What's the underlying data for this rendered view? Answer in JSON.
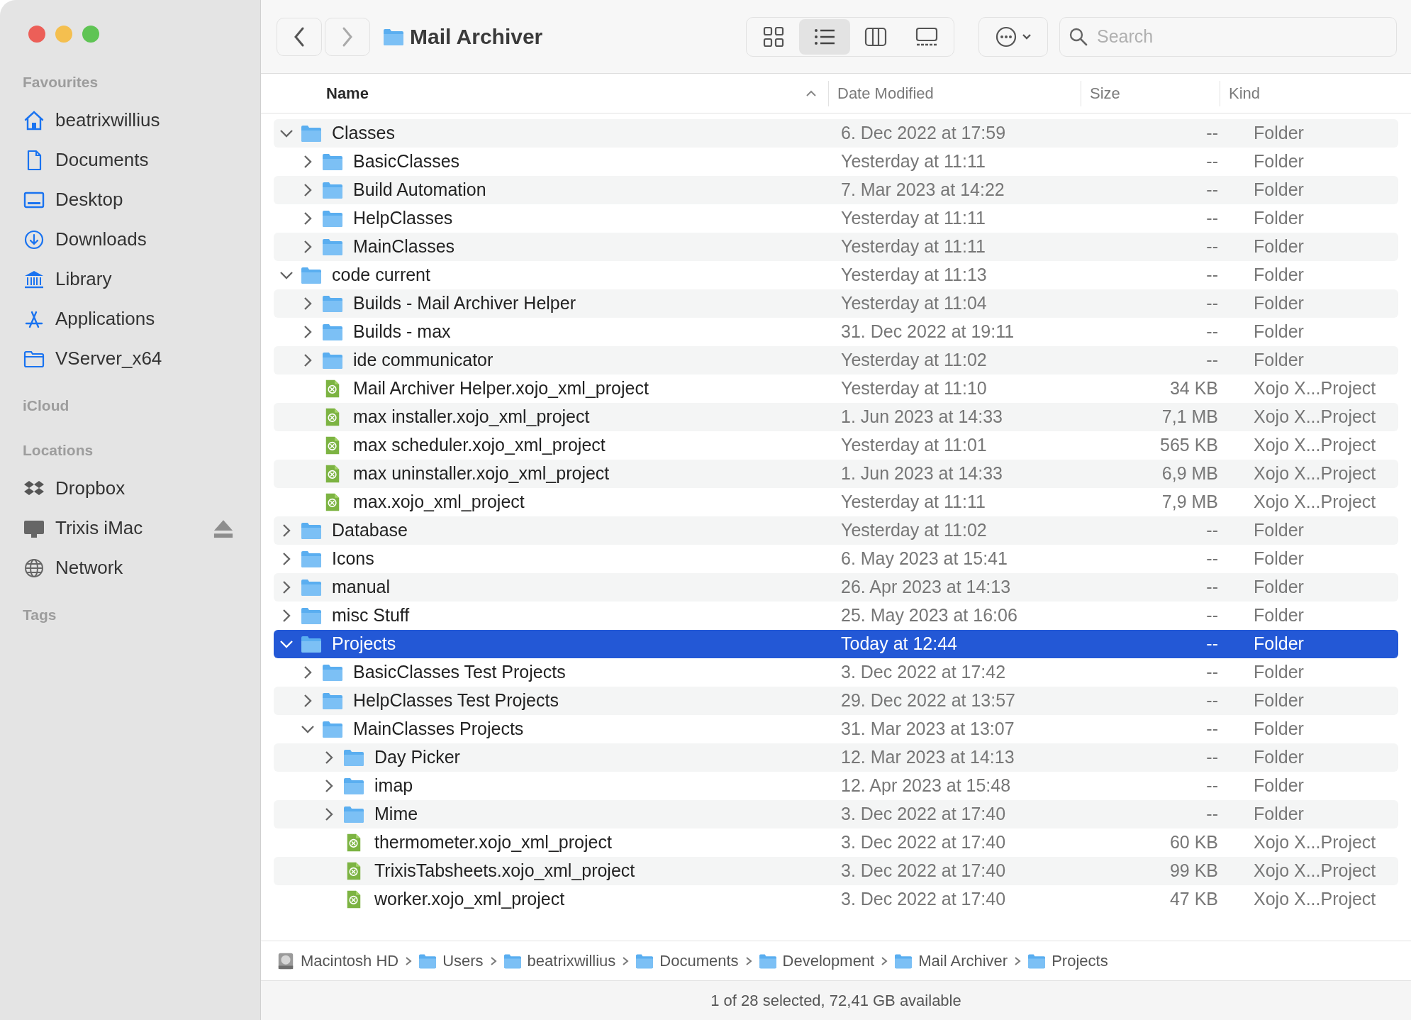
{
  "sidebar": {
    "sections": [
      {
        "title": "Favourites",
        "items": [
          {
            "label": "beatrixwillius",
            "kind": "home"
          },
          {
            "label": "Documents",
            "kind": "document"
          },
          {
            "label": "Desktop",
            "kind": "desktop"
          },
          {
            "label": "Downloads",
            "kind": "download"
          },
          {
            "label": "Library",
            "kind": "library"
          },
          {
            "label": "Applications",
            "kind": "apps"
          },
          {
            "label": "VServer_x64",
            "kind": "folder"
          }
        ]
      },
      {
        "title": "iCloud"
      },
      {
        "title": "Locations",
        "items": [
          {
            "label": "Dropbox",
            "kind": "dropbox"
          },
          {
            "label": "Trixis iMac",
            "kind": "computer",
            "ejectable": true
          },
          {
            "label": "Network",
            "kind": "network"
          }
        ]
      },
      {
        "title": "Tags"
      }
    ]
  },
  "toolbar": {
    "title": "Mail Archiver",
    "views": [
      {
        "kind": "icons",
        "selected": false
      },
      {
        "kind": "list",
        "selected": true
      },
      {
        "kind": "columns",
        "selected": false
      },
      {
        "kind": "gallery",
        "selected": false
      }
    ],
    "search": {
      "placeholder": "Search"
    }
  },
  "table": {
    "columns": [
      {
        "label": "Name",
        "sorted": true
      },
      {
        "label": "Date Modified",
        "sorted": false
      },
      {
        "label": "Size",
        "sorted": false
      },
      {
        "label": "Kind",
        "sorted": false
      }
    ],
    "rows": [
      {
        "name": "Classes",
        "kind": "folder",
        "expanded": true,
        "selected": false,
        "date": "6. Dec 2022 at 17:59",
        "size": "--",
        "type": "Folder",
        "children": [
          {
            "name": "BasicClasses",
            "kind": "folder",
            "expanded": false,
            "selected": false,
            "date": "Yesterday at 11:11",
            "size": "--",
            "type": "Folder"
          },
          {
            "name": "Build Automation",
            "kind": "folder",
            "expanded": false,
            "selected": false,
            "date": "7. Mar 2023 at 14:22",
            "size": "--",
            "type": "Folder"
          },
          {
            "name": "HelpClasses",
            "kind": "folder",
            "expanded": false,
            "selected": false,
            "date": "Yesterday at 11:11",
            "size": "--",
            "type": "Folder"
          },
          {
            "name": "MainClasses",
            "kind": "folder",
            "expanded": false,
            "selected": false,
            "date": "Yesterday at 11:11",
            "size": "--",
            "type": "Folder"
          }
        ]
      },
      {
        "name": "code current",
        "kind": "folder",
        "expanded": true,
        "selected": false,
        "date": "Yesterday at 11:13",
        "size": "--",
        "type": "Folder",
        "children": [
          {
            "name": "Builds - Mail Archiver Helper",
            "kind": "folder",
            "expanded": false,
            "selected": false,
            "date": "Yesterday at 11:04",
            "size": "--",
            "type": "Folder"
          },
          {
            "name": "Builds - max",
            "kind": "folder",
            "expanded": false,
            "selected": false,
            "date": "31. Dec 2022 at 19:11",
            "size": "--",
            "type": "Folder"
          },
          {
            "name": "ide communicator",
            "kind": "folder",
            "expanded": false,
            "selected": false,
            "date": "Yesterday at 11:02",
            "size": "--",
            "type": "Folder"
          },
          {
            "name": "Mail Archiver Helper.xojo_xml_project",
            "kind": "project",
            "selected": false,
            "date": "Yesterday at 11:10",
            "size": "34 KB",
            "type": "Xojo X...Project"
          },
          {
            "name": "max installer.xojo_xml_project",
            "kind": "project",
            "selected": false,
            "date": "1. Jun 2023 at 14:33",
            "size": "7,1 MB",
            "type": "Xojo X...Project"
          },
          {
            "name": "max scheduler.xojo_xml_project",
            "kind": "project",
            "selected": false,
            "date": "Yesterday at 11:01",
            "size": "565 KB",
            "type": "Xojo X...Project"
          },
          {
            "name": "max uninstaller.xojo_xml_project",
            "kind": "project",
            "selected": false,
            "date": "1. Jun 2023 at 14:33",
            "size": "6,9 MB",
            "type": "Xojo X...Project"
          },
          {
            "name": "max.xojo_xml_project",
            "kind": "project",
            "selected": false,
            "date": "Yesterday at 11:11",
            "size": "7,9 MB",
            "type": "Xojo X...Project"
          }
        ]
      },
      {
        "name": "Database",
        "kind": "folder",
        "expanded": false,
        "selected": false,
        "date": "Yesterday at 11:02",
        "size": "--",
        "type": "Folder"
      },
      {
        "name": "Icons",
        "kind": "folder",
        "expanded": false,
        "selected": false,
        "date": "6. May 2023 at 15:41",
        "size": "--",
        "type": "Folder"
      },
      {
        "name": "manual",
        "kind": "folder",
        "expanded": false,
        "selected": false,
        "date": "26. Apr 2023 at 14:13",
        "size": "--",
        "type": "Folder"
      },
      {
        "name": "misc Stuff",
        "kind": "folder",
        "expanded": false,
        "selected": false,
        "date": "25. May 2023 at 16:06",
        "size": "--",
        "type": "Folder"
      },
      {
        "name": "Projects",
        "kind": "folder",
        "expanded": true,
        "selected": true,
        "date": "Today at 12:44",
        "size": "--",
        "type": "Folder",
        "children": [
          {
            "name": "BasicClasses Test Projects",
            "kind": "folder",
            "expanded": false,
            "selected": false,
            "date": "3. Dec 2022 at 17:42",
            "size": "--",
            "type": "Folder"
          },
          {
            "name": "HelpClasses Test Projects",
            "kind": "folder",
            "expanded": false,
            "selected": false,
            "date": "29. Dec 2022 at 13:57",
            "size": "--",
            "type": "Folder"
          },
          {
            "name": "MainClasses Projects",
            "kind": "folder",
            "expanded": true,
            "selected": false,
            "date": "31. Mar 2023 at 13:07",
            "size": "--",
            "type": "Folder",
            "children": [
              {
                "name": "Day Picker",
                "kind": "folder",
                "expanded": false,
                "selected": false,
                "date": "12. Mar 2023 at 14:13",
                "size": "--",
                "type": "Folder"
              },
              {
                "name": "imap",
                "kind": "folder",
                "expanded": false,
                "selected": false,
                "date": "12. Apr 2023 at 15:48",
                "size": "--",
                "type": "Folder"
              },
              {
                "name": "Mime",
                "kind": "folder",
                "expanded": false,
                "selected": false,
                "date": "3. Dec 2022 at 17:40",
                "size": "--",
                "type": "Folder"
              },
              {
                "name": "thermometer.xojo_xml_project",
                "kind": "project",
                "selected": false,
                "date": "3. Dec 2022 at 17:40",
                "size": "60 KB",
                "type": "Xojo X...Project"
              },
              {
                "name": "TrixisTabsheets.xojo_xml_project",
                "kind": "project",
                "selected": false,
                "date": "3. Dec 2022 at 17:40",
                "size": "99 KB",
                "type": "Xojo X...Project"
              },
              {
                "name": "worker.xojo_xml_project",
                "kind": "project",
                "selected": false,
                "date": "3. Dec 2022 at 17:40",
                "size": "47 KB",
                "type": "Xojo X...Project"
              }
            ]
          }
        ]
      }
    ]
  },
  "path_bar": [
    {
      "label": "Macintosh HD",
      "kind": "disk"
    },
    {
      "label": "Users",
      "kind": "folder"
    },
    {
      "label": "beatrixwillius",
      "kind": "folder"
    },
    {
      "label": "Documents",
      "kind": "folder"
    },
    {
      "label": "Development",
      "kind": "folder"
    },
    {
      "label": "Mail Archiver",
      "kind": "folder"
    },
    {
      "label": "Projects",
      "kind": "folder"
    }
  ],
  "status_bar": "1 of 28 selected, 72,41 GB available"
}
